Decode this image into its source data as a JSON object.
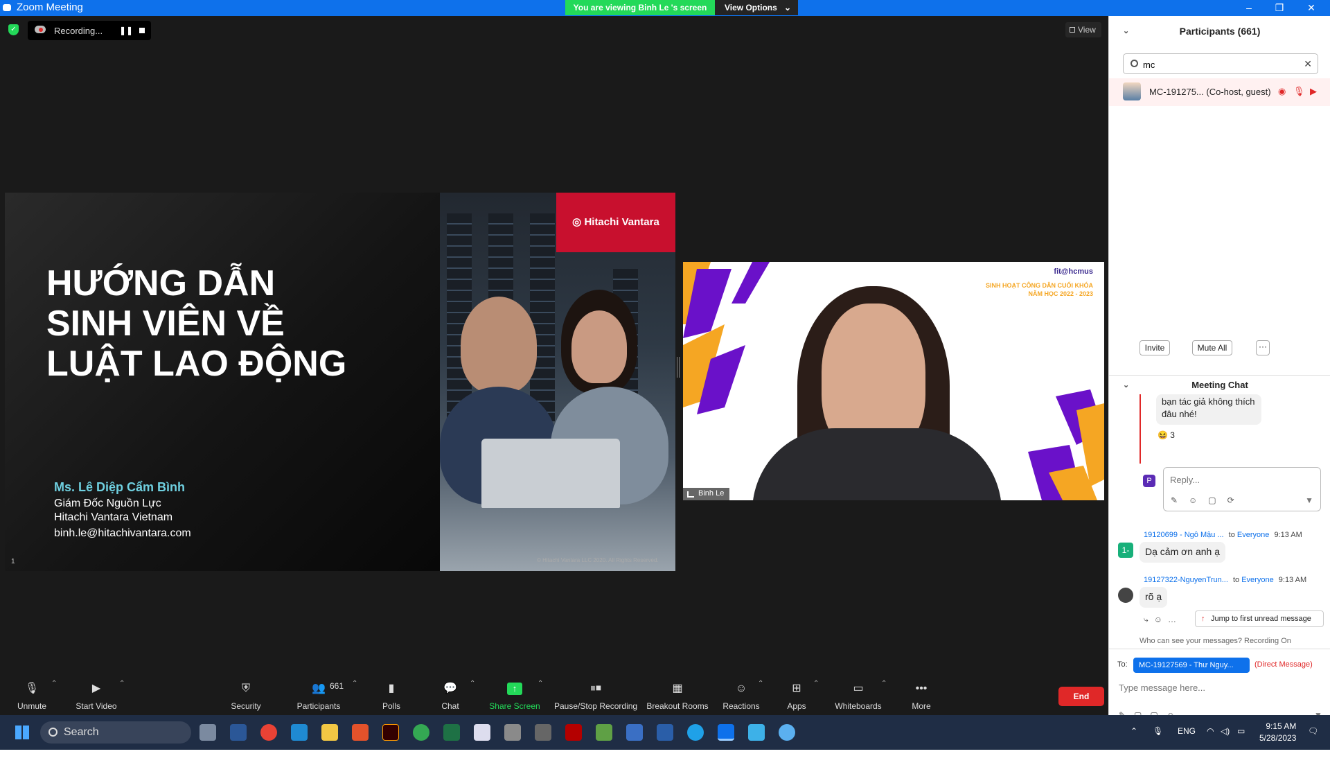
{
  "window": {
    "title": "Zoom Meeting",
    "viewing_banner": "You are viewing Binh Le 's screen",
    "view_options": "View Options",
    "minimize": "–",
    "restore": "❐",
    "close": "✕"
  },
  "meeting": {
    "recording_label": "Recording...",
    "view_label": "View"
  },
  "slide": {
    "title_lines": [
      "HƯỚNG DẪN",
      "SINH VIÊN VỀ",
      "LUẬT LAO ĐỘNG"
    ],
    "name": "Ms. Lê Diệp Cẩm Bình",
    "role": "Giám Đốc Nguồn Lực",
    "company": "Hitachi Vantara Vietnam",
    "email": "binh.le@hitachivantara.com",
    "page_number": "1",
    "brand": "Hitachi Vantara",
    "copyright": "© Hitachi Vantara LLC 2020. All Rights Reserved."
  },
  "video": {
    "participant_name": "Binh Le",
    "brand": "fit@hcmus",
    "subtitle_line1": "SINH HOẠT CÔNG DÂN CUỐI KHÓA",
    "subtitle_line2": "NĂM HỌC 2022 - 2023"
  },
  "toolbar": {
    "items": [
      {
        "label": "Unmute",
        "icon": "microphone-muted-icon"
      },
      {
        "label": "Start Video",
        "icon": "video-off-icon"
      },
      {
        "label": "Security",
        "icon": "shield-icon"
      },
      {
        "label": "Participants",
        "icon": "participants-icon"
      },
      {
        "label": "Polls",
        "icon": "polls-icon"
      },
      {
        "label": "Chat",
        "icon": "chat-icon"
      },
      {
        "label": "Share Screen",
        "icon": "share-screen-icon"
      },
      {
        "label": "Pause/Stop Recording",
        "icon": "pause-stop-icon"
      },
      {
        "label": "Breakout Rooms",
        "icon": "breakout-rooms-icon"
      },
      {
        "label": "Reactions",
        "icon": "reactions-icon"
      },
      {
        "label": "Apps",
        "icon": "apps-icon"
      },
      {
        "label": "Whiteboards",
        "icon": "whiteboards-icon"
      },
      {
        "label": "More",
        "icon": "more-icon"
      }
    ],
    "participant_count": "661",
    "end_label": "End"
  },
  "participants": {
    "title": "Participants (661)",
    "search_value": "mc",
    "rows": [
      {
        "name": "MC-191275... (Co-host, guest)"
      }
    ],
    "invite": "Invite",
    "mute_all": "Mute All",
    "more": "···"
  },
  "chat": {
    "title": "Meeting Chat",
    "partial_message_line1": "bạn tác giả không thích",
    "partial_message_line2": "đâu nhé!",
    "reaction_count": "3",
    "reply_avatar": "P",
    "reply_placeholder": "Reply...",
    "messages": [
      {
        "sender": "19120699 - Ngô Mậu ...",
        "to": "to",
        "recipient": "Everyone",
        "time": "9:13 AM",
        "text": "Dạ cảm ơn anh ạ",
        "avatar": "1-"
      },
      {
        "sender": "19127322-NguyenTrun...",
        "to": "to",
        "recipient": "Everyone",
        "time": "9:13 AM",
        "text": "rõ ạ",
        "avatar": ""
      }
    ],
    "jump_label": "Jump to first unread message",
    "who_can_see": "Who can see your messages? Recording On",
    "to_label": "To:",
    "recipient_select": "MC-19127569 - Thư Nguy...",
    "direct_message": "(Direct Message)",
    "input_placeholder": "Type message here..."
  },
  "taskbar": {
    "search_label": "Search",
    "language": "ENG",
    "time": "9:15 AM",
    "date": "5/28/2023"
  },
  "colors": {
    "zoom_blue": "#0e71eb",
    "green": "#23d959",
    "red": "#e02828",
    "dark": "#1a1a1a"
  }
}
